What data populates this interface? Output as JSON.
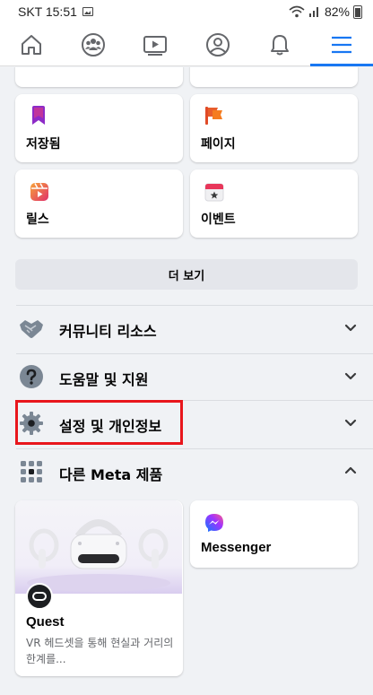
{
  "status": {
    "carrier_time": "SKT 15:51",
    "battery": "82%"
  },
  "nav": {
    "items": [
      "home-icon",
      "friends-icon",
      "watch-icon",
      "profile-icon",
      "notifications-icon",
      "menu-icon"
    ]
  },
  "shortcuts": [
    {
      "label": "저장됨",
      "icon": "bookmark-icon"
    },
    {
      "label": "페이지",
      "icon": "flag-icon"
    },
    {
      "label": "릴스",
      "icon": "reels-icon"
    },
    {
      "label": "이벤트",
      "icon": "calendar-icon"
    }
  ],
  "more_button": "더 보기",
  "sections": [
    {
      "label": "커뮤니티 리소스",
      "icon": "handshake-icon",
      "expanded": false
    },
    {
      "label": "도움말 및 지원",
      "icon": "question-icon",
      "expanded": false
    },
    {
      "label": "설정 및 개인정보",
      "icon": "gear-icon",
      "expanded": false
    },
    {
      "label": "다른 Meta 제품",
      "icon": "grid-icon",
      "expanded": true
    }
  ],
  "products": [
    {
      "title": "Quest",
      "description": "VR 헤드셋을 통해 현실과 거리의 한계를..."
    },
    {
      "title": "Messenger"
    }
  ],
  "colors": {
    "accent": "#1877f2",
    "highlight": "#e8161c"
  }
}
